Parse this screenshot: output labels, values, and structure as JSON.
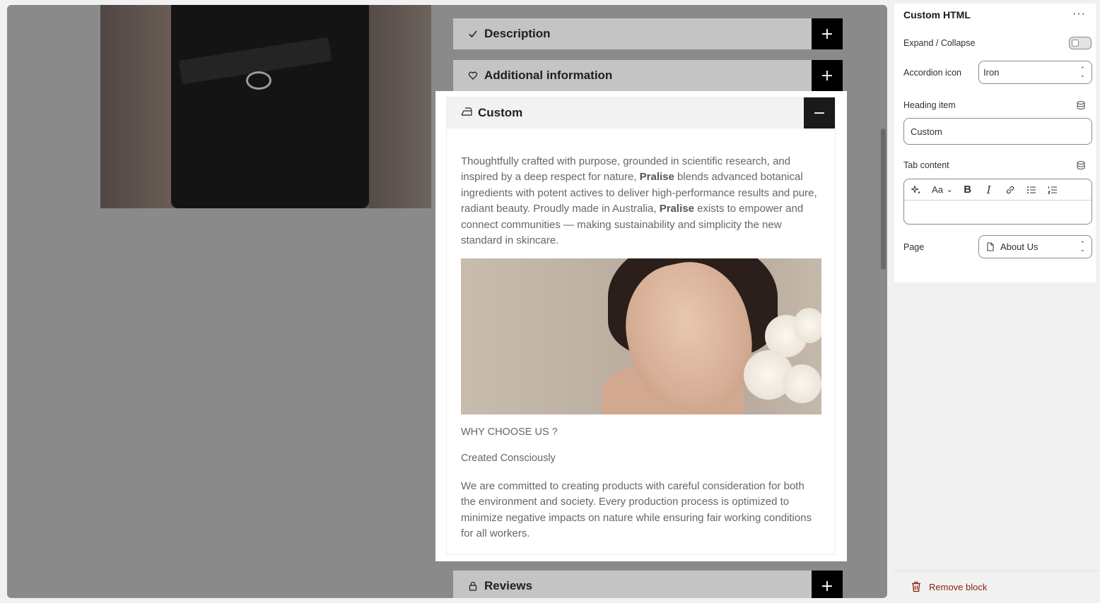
{
  "preview": {
    "accordions": {
      "description": {
        "label": "Description",
        "icon": "check-icon",
        "state": "+"
      },
      "additional": {
        "label": "Additional information",
        "icon": "heart-icon",
        "state": "+"
      },
      "custom": {
        "label": "Custom",
        "icon": "iron-icon",
        "state": "−"
      },
      "reviews": {
        "label": "Reviews",
        "icon": "lock-icon",
        "state": "+"
      }
    },
    "custom_content": {
      "intro_1": "Thoughtfully crafted with purpose, grounded in scientific research, and inspired by a deep respect for nature, ",
      "brand_1": "Pralise",
      "intro_2": " blends advanced botanical ingredients with potent actives to deliver high-performance results and pure, radiant beauty. Proudly made in Australia, ",
      "brand_2": "Pralise",
      "intro_3": " exists to empower and connect communities — making sustainability and simplicity the new standard in skincare.",
      "why_heading": "WHY CHOOSE US ?",
      "sub_heading": "Created Consciously",
      "paragraph": "We are committed to creating products with careful consideration for both the environment and society. Every production process is optimized to minimize negative impacts on nature while ensuring fair working conditions for all workers."
    }
  },
  "settings": {
    "title": "Custom HTML",
    "more_label": "···",
    "expand_label": "Expand / Collapse",
    "accordion_icon_label": "Accordion icon",
    "accordion_icon_value": "Iron",
    "heading_item_label": "Heading item",
    "heading_item_value": "Custom",
    "tab_content_label": "Tab content",
    "rte_tools": [
      "sparkle-icon",
      "font-size-icon",
      "bold-icon",
      "italic-icon",
      "link-icon",
      "bullet-list-icon",
      "numbered-list-icon"
    ],
    "rte_font_label": "Aa",
    "rte_bold_label": "B",
    "rte_italic_label": "I",
    "page_label": "Page",
    "page_value": "About Us",
    "remove_label": "Remove block"
  },
  "colors": {
    "accent_destructive": "#8e1f0b",
    "toggle_button": "#000000"
  }
}
